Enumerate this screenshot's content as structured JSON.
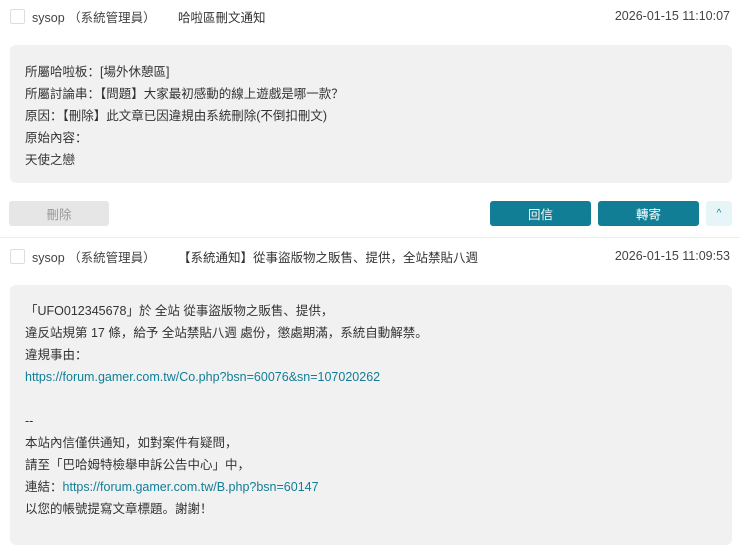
{
  "messages": [
    {
      "sender": "sysop （系統管理員）",
      "subject": "哈啦區刪文通知",
      "time": "2026-01-15 11:10:07",
      "body": [
        "所屬哈啦板：[場外休憩區]",
        "所屬討論串：【問題】大家最初感動的線上遊戲是哪一款？",
        "原因：【刪除】此文章已因違規由系統刪除(不倒扣刪文)",
        "原始內容：",
        "天使之戀"
      ]
    },
    {
      "sender": "sysop （系統管理員）",
      "subject": "【系統通知】從事盜版物之販售、提供，全站禁貼八週",
      "time": "2026-01-15 11:09:53",
      "body": [
        "「UFO012345678」於 全站 從事盜版物之販售、提供，",
        "違反站規第 17 條，給予 全站禁貼八週 處份，懲處期滿，系統自動解禁。",
        "違規事由："
      ],
      "link1": "https://forum.gamer.com.tw/Co.php?bsn=60076&sn=107020262",
      "sep": "--",
      "body2": [
        "本站內信僅供通知，如對案件有疑問，",
        "請至「巴哈姆特檢舉申訴公告中心」中，"
      ],
      "link2_label": "連結：",
      "link2": "https://forum.gamer.com.tw/B.php?bsn=60147",
      "last": "以您的帳號提寫文章標題。謝謝！"
    }
  ],
  "actions": {
    "delete": "刪除",
    "reply": "回信",
    "forward": "轉寄",
    "collapse": "^"
  }
}
